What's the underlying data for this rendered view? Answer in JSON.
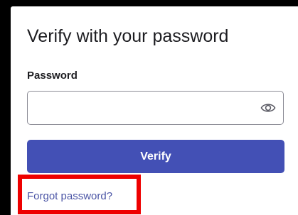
{
  "verify_form": {
    "title": "Verify with your password",
    "password_label": "Password",
    "password_value": "",
    "show_password_icon": "eye-icon",
    "submit_label": "Verify",
    "forgot_link": "Forgot password?"
  },
  "colors": {
    "primary_button": "#4350b5",
    "link": "#4c56a6",
    "highlight": "#ee0000",
    "background": "#000000"
  }
}
